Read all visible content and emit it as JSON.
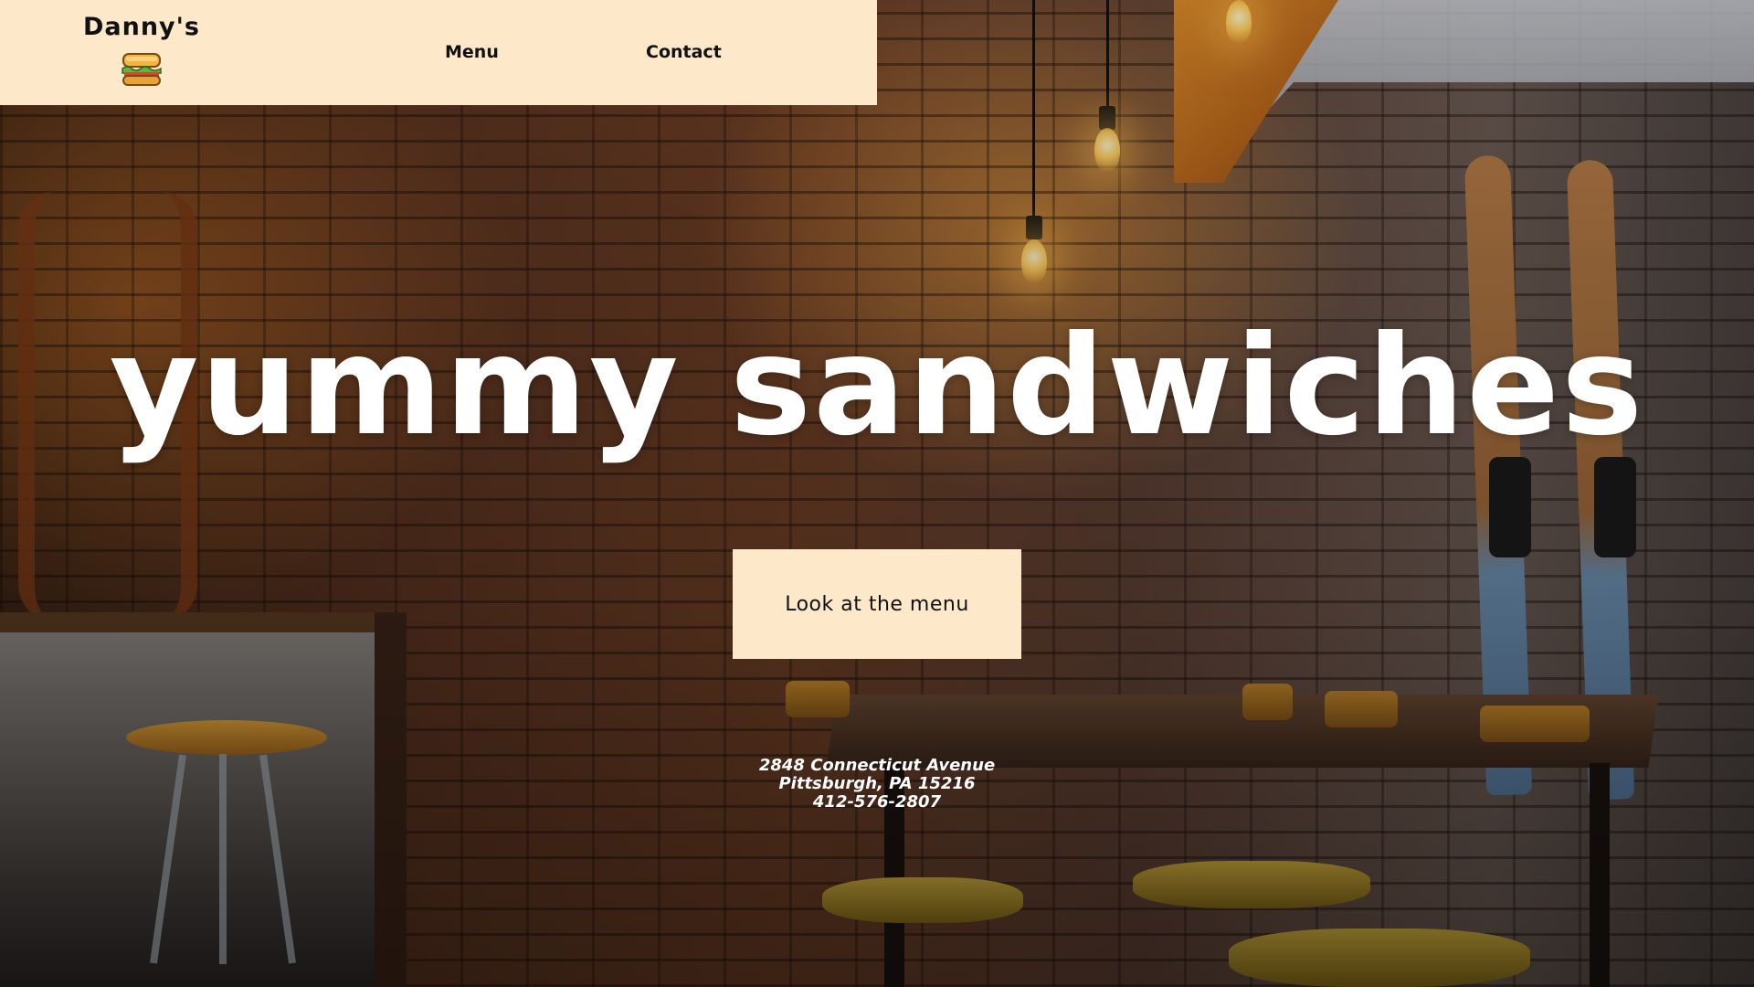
{
  "header": {
    "brand_name": "Danny's",
    "logo_icon": "sandwich-icon",
    "nav": {
      "menu_label": "Menu",
      "contact_label": "Contact"
    }
  },
  "hero": {
    "title": "yummy sandwiches",
    "cta_label": "Look at the menu"
  },
  "address": {
    "street": "2848 Connecticut Avenue",
    "city": "Pittsburgh, PA 15216",
    "phone": "412-576-2807"
  },
  "colors": {
    "header_bg": "#fde9c9",
    "button_bg": "#fde9c9",
    "text_dark": "#111111",
    "text_light": "#ffffff"
  },
  "background_image": "cafe interior with brick wall, hanging light bulbs, wooden table, chairs and water skis"
}
